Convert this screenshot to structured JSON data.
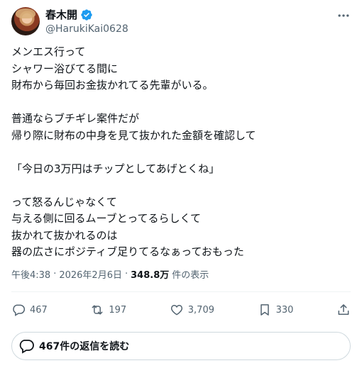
{
  "author": {
    "display_name": "春木開",
    "handle": "@HarukiKai0628"
  },
  "post": {
    "text": "メンエス行って\nシャワー浴びてる間に\n財布から毎回お金抜かれてる先輩がいる。\n\n普通ならブチギレ案件だが\n帰り際に財布の中身を見て抜かれた金額を確認して\n\n「今日の3万円はチップとしてあげとくね」\n\nって怒るんじゃなくて\n与える側に回るムーブとってるらしくて\n抜かれて抜かれるのは\n器の広さにポジティブ足りてるなぁっておもった",
    "time": "午後4:38",
    "separator": "·",
    "date": "2026年2月6日",
    "views_count": "348.8万",
    "views_label": "件の表示"
  },
  "actions": {
    "replies": "467",
    "reposts": "197",
    "likes": "3,709",
    "bookmarks": "330"
  },
  "read_replies_label": "467件の返信を読む",
  "colors": {
    "text": "#0f1419",
    "secondary": "#536471",
    "verified": "#1d9bf0",
    "border": "#cfd9de"
  }
}
